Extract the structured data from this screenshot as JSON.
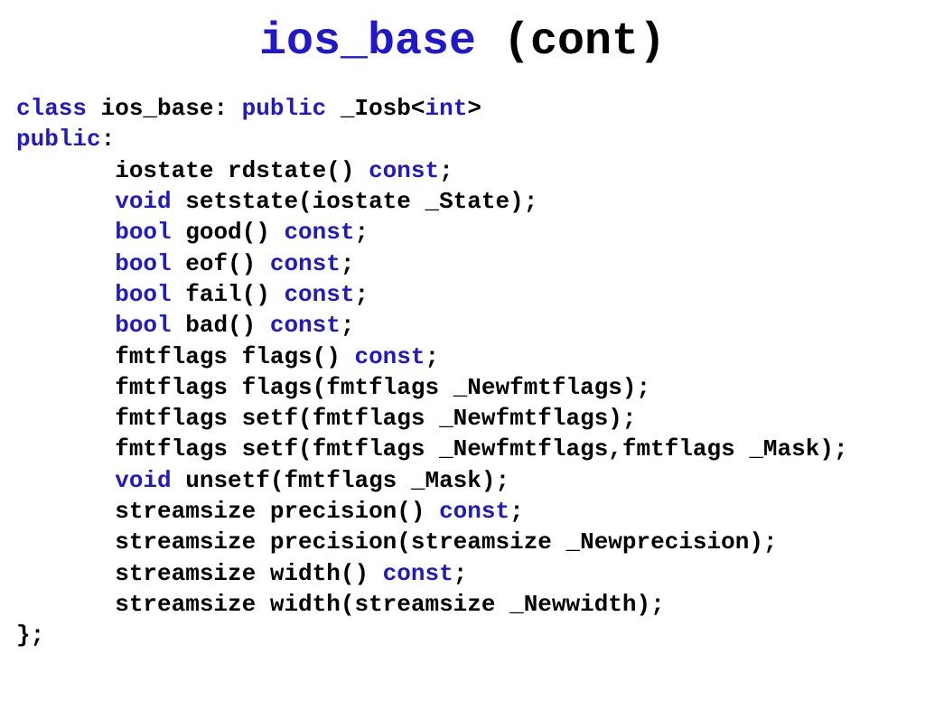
{
  "title": {
    "code": "ios_base",
    "suffix": " (cont)"
  },
  "code": {
    "l0": {
      "a": "class ",
      "b": "ios_base: ",
      "c": "public ",
      "d": "_Iosb<",
      "e": "int",
      "f": ">"
    },
    "l1": {
      "a": "public",
      "b": ":"
    },
    "l2": {
      "a": "       iostate rdstate() ",
      "b": "const",
      "c": ";"
    },
    "l3": {
      "a": "       ",
      "b": "void ",
      "c": "setstate(iostate _State);"
    },
    "l4": {
      "a": "       ",
      "b": "bool ",
      "c": "good() ",
      "d": "const",
      "e": ";"
    },
    "l5": {
      "a": "       ",
      "b": "bool ",
      "c": "eof() ",
      "d": "const",
      "e": ";"
    },
    "l6": {
      "a": "       ",
      "b": "bool ",
      "c": "fail() ",
      "d": "const",
      "e": ";"
    },
    "l7": {
      "a": "       ",
      "b": "bool ",
      "c": "bad() ",
      "d": "const",
      "e": ";"
    },
    "l8": {
      "a": "       fmtflags flags() ",
      "b": "const",
      "c": ";"
    },
    "l9": "       fmtflags flags(fmtflags _Newfmtflags);",
    "l10": "       fmtflags setf(fmtflags _Newfmtflags);",
    "l11": "       fmtflags setf(fmtflags _Newfmtflags,fmtflags _Mask);",
    "l12": {
      "a": "       ",
      "b": "void ",
      "c": "unsetf(fmtflags _Mask);"
    },
    "l13": {
      "a": "       streamsize precision() ",
      "b": "const",
      "c": ";"
    },
    "l14": "       streamsize precision(streamsize _Newprecision);",
    "l15": {
      "a": "       streamsize width() ",
      "b": "const",
      "c": ";"
    },
    "l16": "       streamsize width(streamsize _Newwidth);",
    "l17": "};"
  }
}
